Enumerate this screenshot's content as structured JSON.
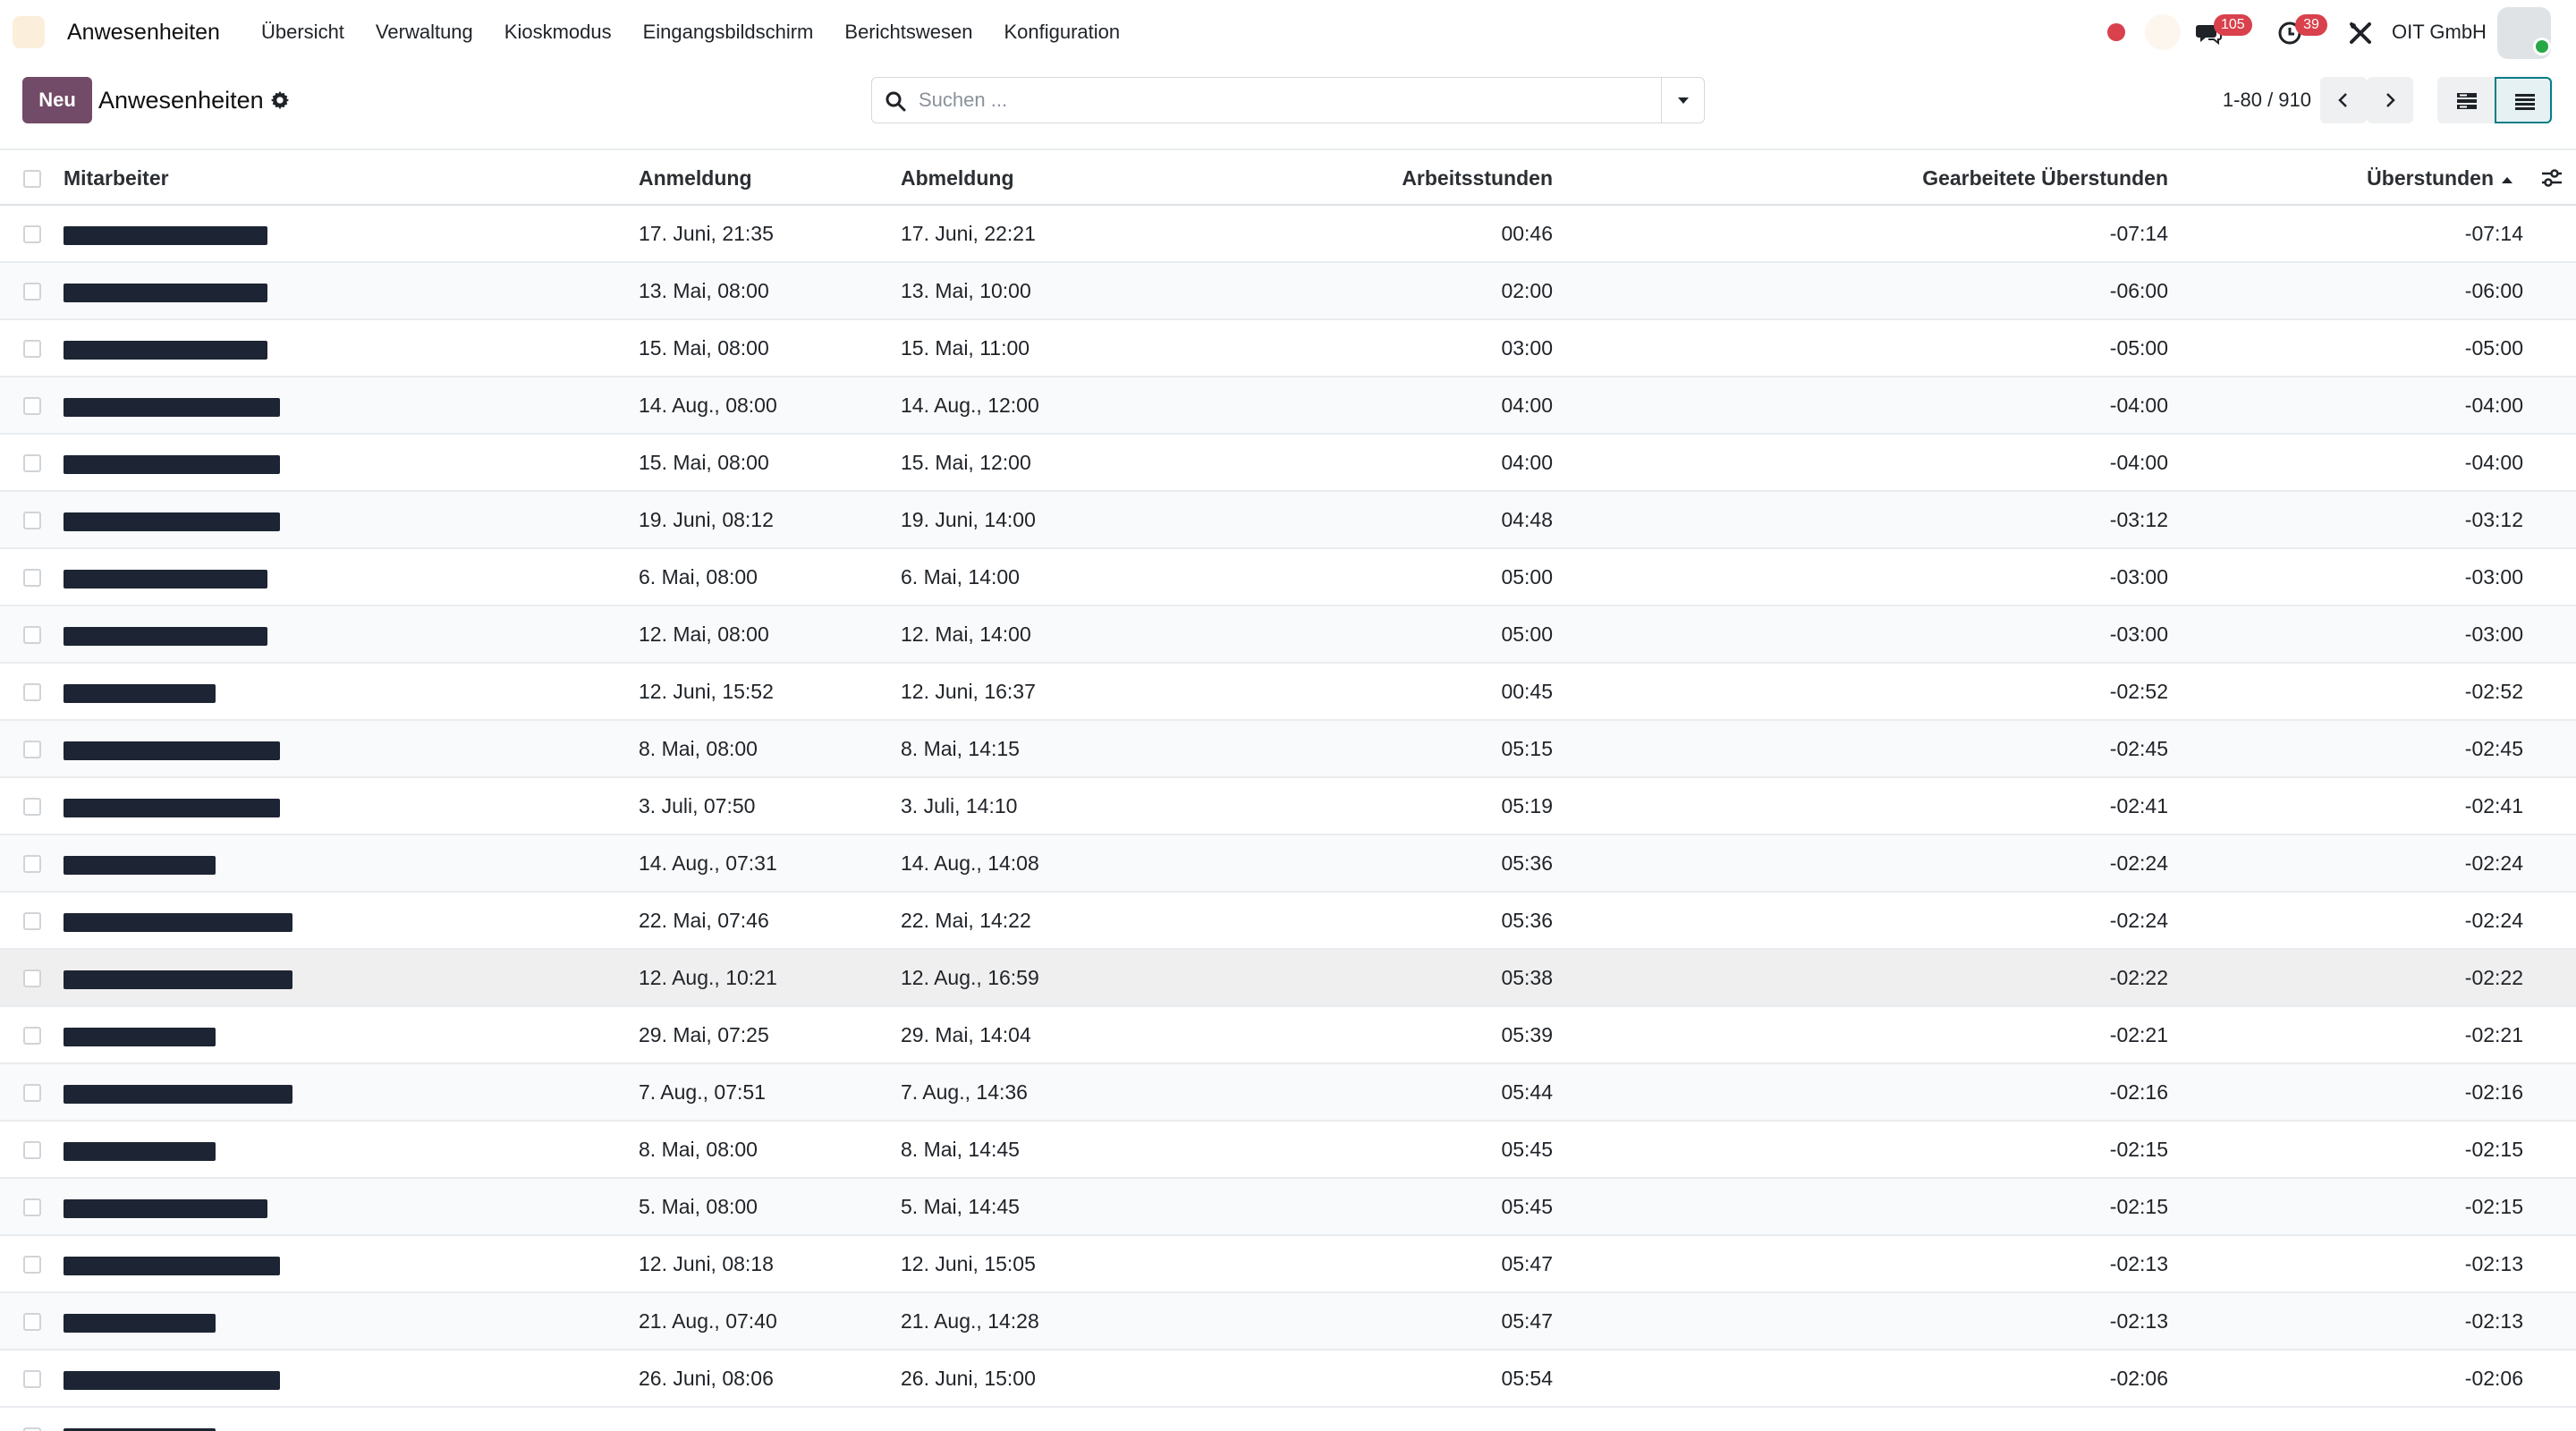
{
  "navbar": {
    "app_title": "Anwesenheiten",
    "menu": [
      "Übersicht",
      "Verwaltung",
      "Kioskmodus",
      "Eingangsbildschirm",
      "Berichtswesen",
      "Konfiguration"
    ],
    "messages_badge": "105",
    "activities_badge": "39",
    "company": "OIT GmbH"
  },
  "control": {
    "new_label": "Neu",
    "breadcrumb": "Anwesenheiten",
    "search_placeholder": "Suchen ...",
    "pager": "1-80 / 910"
  },
  "table": {
    "headers": {
      "employee": "Mitarbeiter",
      "check_in": "Anmeldung",
      "check_out": "Abmeldung",
      "worked_hours": "Arbeitsstunden",
      "worked_overtime": "Gearbeitete Überstunden",
      "overtime": "Überstunden"
    },
    "rows": [
      {
        "check_in": "17. Juni, 21:35",
        "check_out": "17. Juni, 22:21",
        "hours": "00:46",
        "worked_overtime": "-07:14",
        "overtime": "-07:14"
      },
      {
        "check_in": "13. Mai, 08:00",
        "check_out": "13. Mai, 10:00",
        "hours": "02:00",
        "worked_overtime": "-06:00",
        "overtime": "-06:00"
      },
      {
        "check_in": "15. Mai, 08:00",
        "check_out": "15. Mai, 11:00",
        "hours": "03:00",
        "worked_overtime": "-05:00",
        "overtime": "-05:00"
      },
      {
        "check_in": "14. Aug., 08:00",
        "check_out": "14. Aug., 12:00",
        "hours": "04:00",
        "worked_overtime": "-04:00",
        "overtime": "-04:00"
      },
      {
        "check_in": "15. Mai, 08:00",
        "check_out": "15. Mai, 12:00",
        "hours": "04:00",
        "worked_overtime": "-04:00",
        "overtime": "-04:00"
      },
      {
        "check_in": "19. Juni, 08:12",
        "check_out": "19. Juni, 14:00",
        "hours": "04:48",
        "worked_overtime": "-03:12",
        "overtime": "-03:12"
      },
      {
        "check_in": "6. Mai, 08:00",
        "check_out": "6. Mai, 14:00",
        "hours": "05:00",
        "worked_overtime": "-03:00",
        "overtime": "-03:00"
      },
      {
        "check_in": "12. Mai, 08:00",
        "check_out": "12. Mai, 14:00",
        "hours": "05:00",
        "worked_overtime": "-03:00",
        "overtime": "-03:00"
      },
      {
        "check_in": "12. Juni, 15:52",
        "check_out": "12. Juni, 16:37",
        "hours": "00:45",
        "worked_overtime": "-02:52",
        "overtime": "-02:52"
      },
      {
        "check_in": "8. Mai, 08:00",
        "check_out": "8. Mai, 14:15",
        "hours": "05:15",
        "worked_overtime": "-02:45",
        "overtime": "-02:45"
      },
      {
        "check_in": "3. Juli, 07:50",
        "check_out": "3. Juli, 14:10",
        "hours": "05:19",
        "worked_overtime": "-02:41",
        "overtime": "-02:41"
      },
      {
        "check_in": "14. Aug., 07:31",
        "check_out": "14. Aug., 14:08",
        "hours": "05:36",
        "worked_overtime": "-02:24",
        "overtime": "-02:24"
      },
      {
        "check_in": "22. Mai, 07:46",
        "check_out": "22. Mai, 14:22",
        "hours": "05:36",
        "worked_overtime": "-02:24",
        "overtime": "-02:24"
      },
      {
        "check_in": "12. Aug., 10:21",
        "check_out": "12. Aug., 16:59",
        "hours": "05:38",
        "worked_overtime": "-02:22",
        "overtime": "-02:22"
      },
      {
        "check_in": "29. Mai, 07:25",
        "check_out": "29. Mai, 14:04",
        "hours": "05:39",
        "worked_overtime": "-02:21",
        "overtime": "-02:21"
      },
      {
        "check_in": "7. Aug., 07:51",
        "check_out": "7. Aug., 14:36",
        "hours": "05:44",
        "worked_overtime": "-02:16",
        "overtime": "-02:16"
      },
      {
        "check_in": "8. Mai, 08:00",
        "check_out": "8. Mai, 14:45",
        "hours": "05:45",
        "worked_overtime": "-02:15",
        "overtime": "-02:15"
      },
      {
        "check_in": "5. Mai, 08:00",
        "check_out": "5. Mai, 14:45",
        "hours": "05:45",
        "worked_overtime": "-02:15",
        "overtime": "-02:15"
      },
      {
        "check_in": "12. Juni, 08:18",
        "check_out": "12. Juni, 15:05",
        "hours": "05:47",
        "worked_overtime": "-02:13",
        "overtime": "-02:13"
      },
      {
        "check_in": "21. Aug., 07:40",
        "check_out": "21. Aug., 14:28",
        "hours": "05:47",
        "worked_overtime": "-02:13",
        "overtime": "-02:13"
      },
      {
        "check_in": "26. Juni, 08:06",
        "check_out": "26. Juni, 15:00",
        "hours": "05:54",
        "worked_overtime": "-02:06",
        "overtime": "-02:06"
      }
    ]
  },
  "colors": {
    "primary": "#714b67",
    "badge": "#d9414d",
    "active_view": "#017e84",
    "redaction": "#1d2433"
  }
}
